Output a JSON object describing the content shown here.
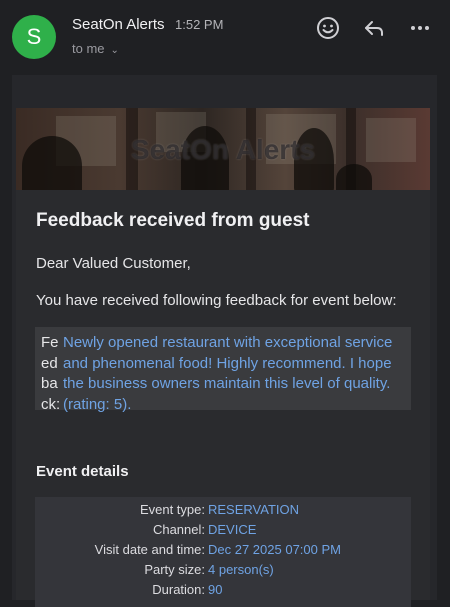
{
  "header": {
    "avatar_letter": "S",
    "avatar_color": "#2fb04a",
    "sender": "SeatOn Alerts",
    "time": "1:52 PM",
    "recipient": "to me",
    "icons": [
      "emoji-reaction-icon",
      "reply-icon",
      "more-options-icon"
    ]
  },
  "email": {
    "banner_title": "SeatOn Alerts",
    "heading": "Feedback received from guest",
    "greeting": "Dear Valued Customer,",
    "intro": "You have received following feedback for event below:",
    "feedback_label": "Feedback:",
    "feedback_text": "Newly opened restaurant with exceptional service and phenomenal food! Highly recommend. I hope the business owners maintain this level of quality. (rating: 5).",
    "event_details_title": "Event details",
    "event_details": [
      {
        "key": "Event type:",
        "value": "RESERVATION"
      },
      {
        "key": "Channel:",
        "value": "DEVICE"
      },
      {
        "key": "Visit date and time:",
        "value": "Dec 27 2025 07:00 PM"
      },
      {
        "key": "Party size:",
        "value": "4 person(s)"
      },
      {
        "key": "Duration:",
        "value": "90"
      }
    ],
    "link_color": "#6fa3e4"
  }
}
